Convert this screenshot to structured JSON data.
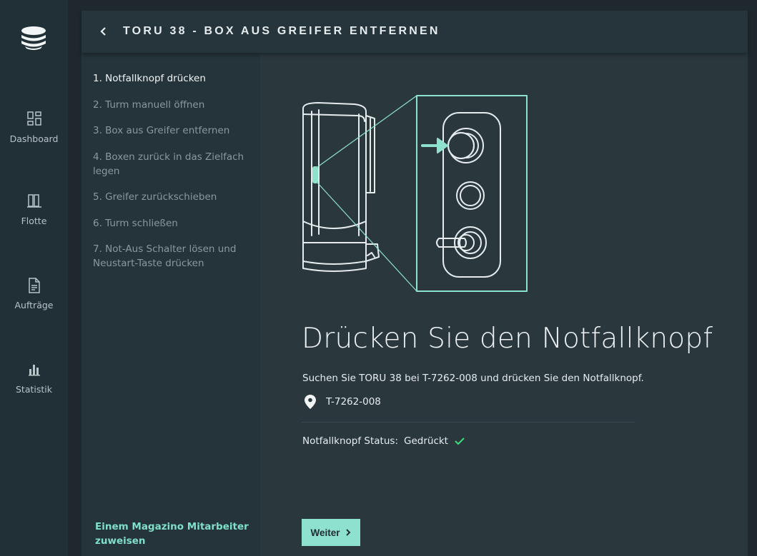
{
  "sidebar": {
    "logo": "magazino-logo",
    "items": [
      {
        "label": "Dashboard",
        "icon": "dashboard-grid-icon"
      },
      {
        "label": "Flotte",
        "icon": "fleet-icon"
      },
      {
        "label": "Aufträge",
        "icon": "document-icon"
      },
      {
        "label": "Statistik",
        "icon": "bar-chart-icon"
      }
    ]
  },
  "header": {
    "back_icon": "chevron-left-icon",
    "title": "TORU 38 - BOX AUS GREIFER ENTFERNEN"
  },
  "steps": [
    {
      "label": "1. Notfallknopf drücken",
      "active": true
    },
    {
      "label": "2. Turm manuell öffnen",
      "active": false
    },
    {
      "label": "3. Box aus Greifer entfernen",
      "active": false
    },
    {
      "label": "4. Boxen zurück in das Zielfach legen",
      "active": false
    },
    {
      "label": "5. Greifer zurückschieben",
      "active": false
    },
    {
      "label": "6. Turm schließen",
      "active": false
    },
    {
      "label": "7. Not-Aus Schalter lösen und Neustart-Taste drücken",
      "active": false
    }
  ],
  "assign_link": "Einem Magazino Mitarbeiter zuweisen",
  "main": {
    "heading": "Drücken Sie den Notfallknopf",
    "instruction": "Suchen Sie TORU 38 bei T-7262-008 und drücken Sie den Notfallknopf.",
    "location": "T-7262-008",
    "status_label": "Notfallknopf Status:",
    "status_value": "Gedrückt",
    "next_button": "Weiter"
  },
  "colors": {
    "accent": "#8ee2cd",
    "link": "#7fe0c8",
    "check": "#3ddc7a",
    "sidebar_bg": "#213036",
    "main_bg": "#2a383e"
  }
}
